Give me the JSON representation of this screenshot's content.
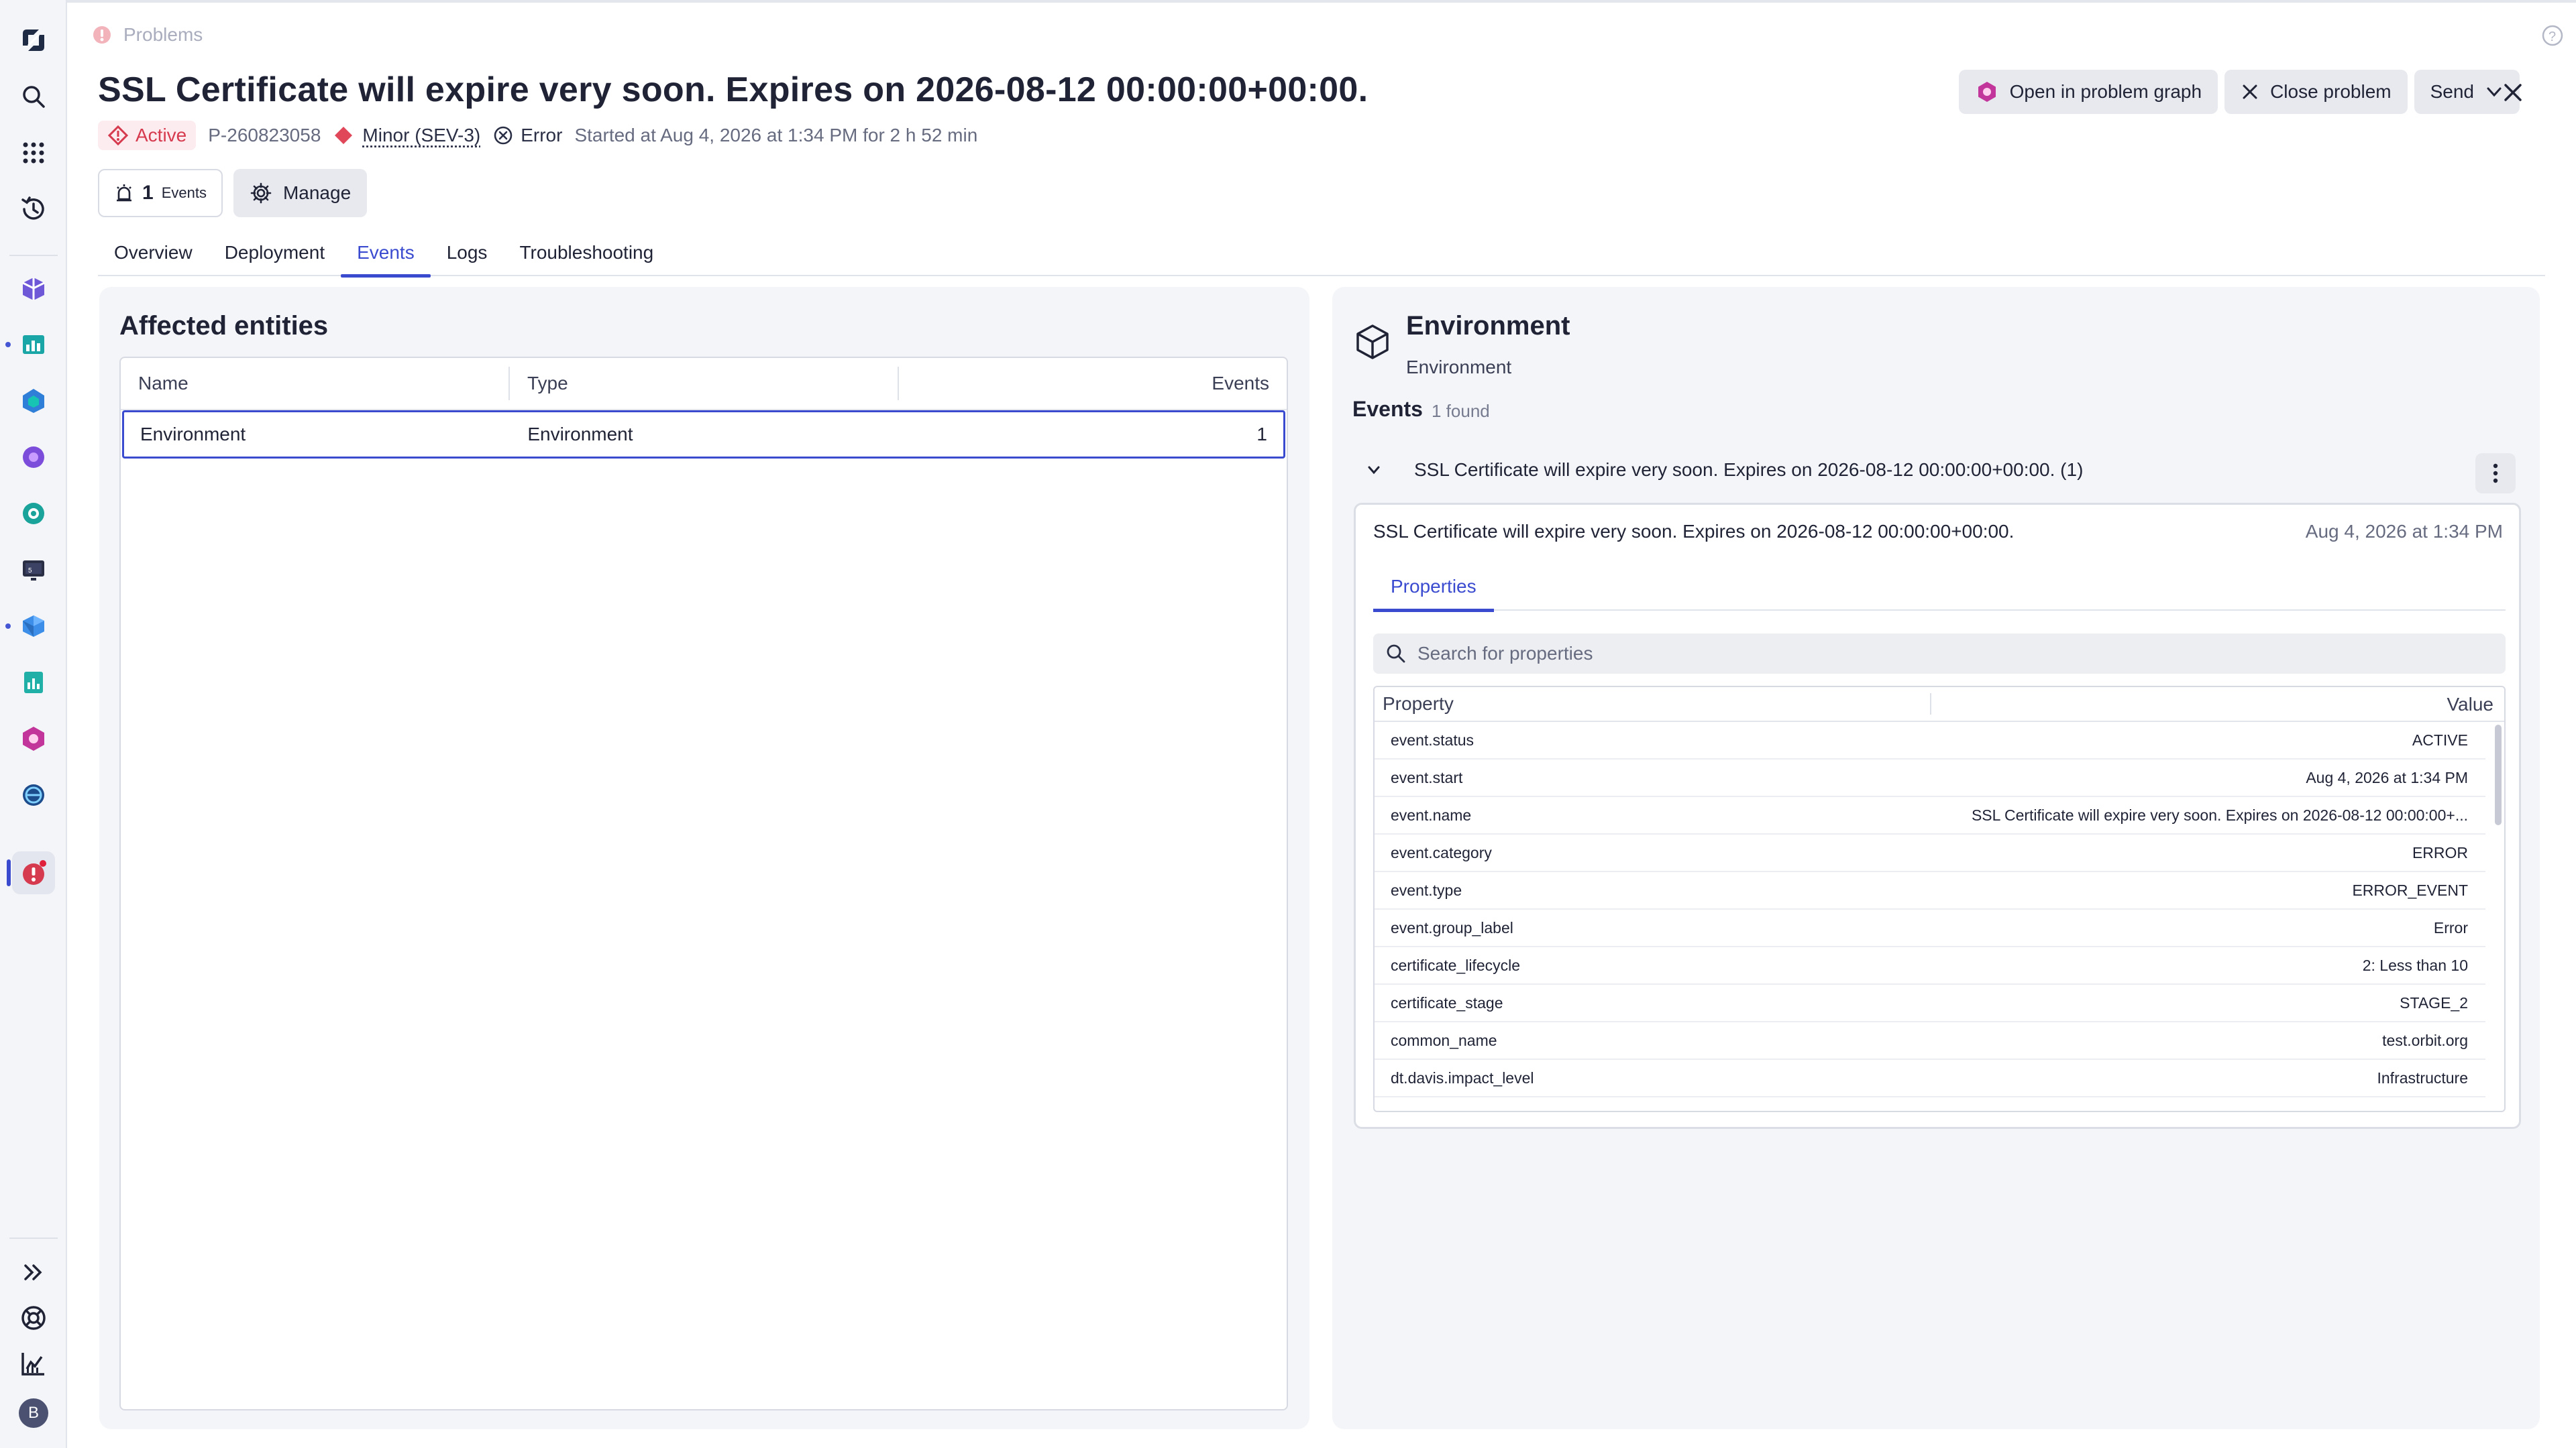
{
  "strip": {
    "title": "Problems"
  },
  "problem": {
    "title": "SSL Certificate will expire very soon. Expires on 2026-08-12 00:00:00+00:00.",
    "status": "Active",
    "id": "P-260823058",
    "severity": "Minor (SEV-3)",
    "category": "Error",
    "started": "Started at Aug 4, 2026 at 1:34 PM for 2 h 52 min"
  },
  "actions": {
    "open_graph": "Open in problem graph",
    "close_problem": "Close problem",
    "send": "Send"
  },
  "subbar": {
    "events_count": "1",
    "events_label": "Events",
    "manage": "Manage"
  },
  "tabs": [
    {
      "label": "Overview"
    },
    {
      "label": "Deployment"
    },
    {
      "label": "Events"
    },
    {
      "label": "Logs"
    },
    {
      "label": "Troubleshooting"
    }
  ],
  "affected": {
    "title": "Affected entities",
    "columns": [
      "Name",
      "Type",
      "Events"
    ],
    "rows": [
      {
        "name": "Environment",
        "type": "Environment",
        "events": "1"
      }
    ]
  },
  "detail": {
    "entity_title": "Environment",
    "entity_subtitle": "Environment",
    "events_heading": "Events",
    "events_found": "1 found",
    "group_title": "SSL Certificate will expire very soon. Expires on 2026-08-12 00:00:00+00:00. (1)",
    "card_title": "SSL Certificate will expire very soon. Expires on 2026-08-12 00:00:00+00:00.",
    "card_date": "Aug 4, 2026 at 1:34 PM",
    "properties_tab": "Properties",
    "search_placeholder": "Search for properties",
    "columns": [
      "Property",
      "Value"
    ],
    "properties": [
      {
        "key": "event.status",
        "value": "ACTIVE"
      },
      {
        "key": "event.start",
        "value": "Aug 4, 2026 at 1:34 PM"
      },
      {
        "key": "event.name",
        "value": "SSL Certificate will expire very soon. Expires on 2026-08-12 00:00:00+..."
      },
      {
        "key": "event.category",
        "value": "ERROR"
      },
      {
        "key": "event.type",
        "value": "ERROR_EVENT"
      },
      {
        "key": "event.group_label",
        "value": "Error"
      },
      {
        "key": "certificate_lifecycle",
        "value": "2: Less than 10"
      },
      {
        "key": "certificate_stage",
        "value": "STAGE_2"
      },
      {
        "key": "common_name",
        "value": "test.orbit.org"
      },
      {
        "key": "dt.davis.impact_level",
        "value": "Infrastructure"
      }
    ]
  },
  "rail": {
    "avatar_initial": "B"
  },
  "colors": {
    "accent": "#3a4bd0",
    "danger": "#d63a4e",
    "brand": "#c2359a"
  }
}
